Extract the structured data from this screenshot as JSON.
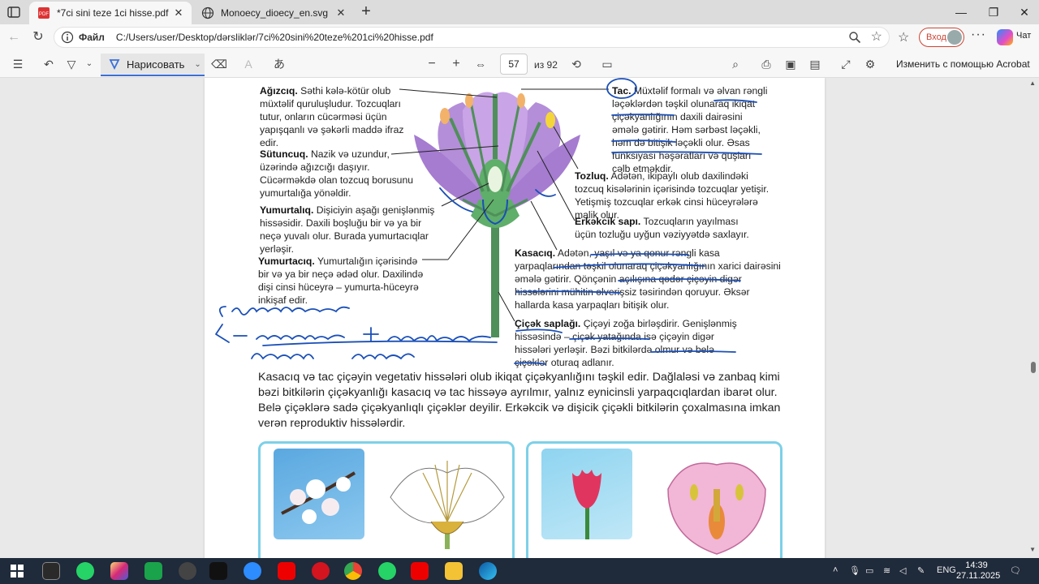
{
  "tabs": [
    {
      "title": "*7ci sini teze 1ci hisse.pdf",
      "active": true
    },
    {
      "title": "Monoecy_dioecy_en.svg",
      "active": false
    }
  ],
  "address": {
    "file_label": "Файл",
    "url": "C:/Users/user/Desktop/dərsliklər/7ci%20sini%20teze%201ci%20hisse.pdf"
  },
  "profile": {
    "signin_label": "Вход"
  },
  "pdf_toolbar": {
    "draw_label": "Нарисовать",
    "page_current": "57",
    "page_of": "из 92",
    "acrobat_label": "Изменить с помощью Acrobat"
  },
  "doc": {
    "agizciq_title": "Ağızcıq.",
    "agizciq_text": "Səthi kələ-kötür olub müxtəlif quruluşludur. Tozcuqları tutur, onların cücərməsi üçün yapışqanlı və şəkərli maddə ifraz edir.",
    "sutuncuq_title": "Sütuncuq.",
    "sutuncuq_text": "Nazik və uzundur, üzərində ağızcığı daşıyır. Cücərməkdə olan tozcuq borusunu yumurtalığa yönəldir.",
    "yumurtaliq_title": "Yumurtalıq.",
    "yumurtaliq_text": "Dişiciyin aşağı genişlənmiş hissəsidir. Daxili boşluğu bir və ya bir neçə yuvalı olur. Burada yumurtacıqlar yerləşir.",
    "yumurtaciq_title": "Yumurtacıq.",
    "yumurtaciq_text": "Yumurtalığın içərisində bir və ya bir neçə ədəd olur. Daxilində dişi cinsi hüceyrə – yumurta-hüceyrə inkişaf edir.",
    "tac_title": "Tac.",
    "tac_text": "Müxtəlif formalı və əlvan rəngli ləçəklərdən təşkil olunaraq ikiqat çiçəkyanlığının daxili dairəsini əmələ gətirir. Həm sərbəst ləçəkli, həm də bitişik ləçəkli olur. Əsas funksiyası həşəratları və quşları cəlb etməkdir.",
    "tozluq_title": "Tozluq.",
    "tozluq_text": "Adətən, ikipaylı olub daxilindəki tozcuq kisələrinin içərisində tozcuqlar yetişir. Yetişmiş tozcuqlar erkək cinsi hüceyrələrə malik olur.",
    "erkekcik_title": "Erkəkcik sapı.",
    "erkekcik_text": "Tozcuqların yayılması üçün tozluğu uyğun vəziyyətdə saxlayır.",
    "kasaciq_title": "Kasacıq.",
    "kasaciq_text": "Adətən, yaşıl və ya qonur rəngli kasa yarpaqlarından təşkil olunaraq çiçəkyanlığının xarici dairəsini əmələ gətirir. Qönçənin açılışına qədər çiçəyin digər hissələrini mühitin əlverişsiz təsirindən qoruyur. Əksər hallarda kasa yarpaqları bitişik olur.",
    "sapligi_title": "Çiçək saplağı.",
    "sapligi_text": "Çiçəyi zoğa birləşdirir. Genişlənmiş hissəsində – çiçək yatağında isə çiçəyin digər hissələri yerləşir. Bəzi bitkilərdə olmur və belə çiçəklər oturaq adlanır.",
    "main_paragraph": "Kasacıq və tac çiçəyin vegetativ hissələri olub ikiqat çiçəkyanlığını təşkil edir. Dağlaləsi və zanbaq kimi bəzi bitkilərin çiçəkyanlığı kasacıq və tac hissəyə ayrılmır, yalnız eynicinsli yarpaqcıqlardan ibarət olur. Belə çiçəklərə sadə çiçəkyanlıqlı çiçəklər deyilir. Erkəkcik və dişicik çiçəkli bitkilərin çoxalmasına imkan verən reproduktiv hissələrdir."
  },
  "taskbar": {
    "lang": "ENG",
    "time": "14:39",
    "date": "27.11.2025"
  },
  "colors": {
    "accent": "#3b6fd8",
    "ink": "#1a4fb8",
    "card_border": "#7dd0e8",
    "petal": "#b68fd8",
    "stem": "#4f8f5a"
  }
}
